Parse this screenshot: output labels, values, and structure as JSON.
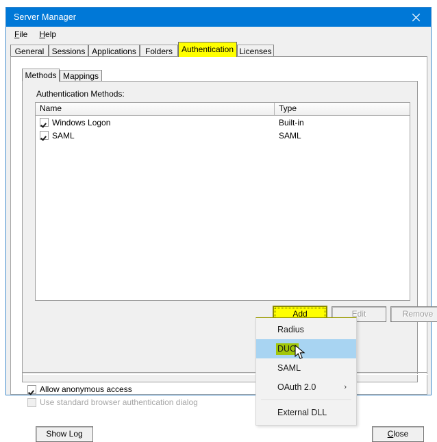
{
  "window": {
    "title": "Server Manager",
    "close_icon": "close-icon",
    "accent_titlebar": "#0078D7",
    "highlight_yellow": "#FFFF00",
    "menu_selection_blue": "#A8D4F2",
    "menu_item_highlight_green": "#A2C60A"
  },
  "menubar": {
    "items": [
      {
        "label": "File",
        "accel": "F"
      },
      {
        "label": "Help",
        "accel": "H"
      }
    ]
  },
  "outer_tabs": {
    "items": [
      {
        "label": "General",
        "active": false
      },
      {
        "label": "Sessions",
        "active": false
      },
      {
        "label": "Applications",
        "active": false
      },
      {
        "label": "Folders",
        "active": false
      },
      {
        "label": "Authentication",
        "active": true
      },
      {
        "label": "Licenses",
        "active": false
      }
    ]
  },
  "inner_tabs": {
    "items": [
      {
        "label": "Methods",
        "active": true
      },
      {
        "label": "Mappings",
        "active": false
      }
    ]
  },
  "methods_panel": {
    "group_label": "Authentication Methods:",
    "columns": [
      "Name",
      "Type"
    ],
    "rows": [
      {
        "checked": true,
        "name": "Windows Logon",
        "type": "Built-in"
      },
      {
        "checked": true,
        "name": "SAML",
        "type": "SAML"
      }
    ],
    "buttons": {
      "add": {
        "label": "Add",
        "enabled": true,
        "focused": true,
        "highlighted": true
      },
      "edit": {
        "label": "Edit",
        "enabled": false
      },
      "remove": {
        "label": "Remove",
        "enabled": false
      }
    }
  },
  "options": {
    "allow_anonymous": {
      "label": "Allow anonymous access",
      "checked": true,
      "enabled": true
    },
    "standard_browser_dialog": {
      "label": "Use standard browser authentication dialog",
      "checked": false,
      "enabled": false
    }
  },
  "footer": {
    "show_log": {
      "label": "Show Log",
      "accel": ""
    },
    "close": {
      "label": "Close",
      "accel": "C"
    }
  },
  "add_menu": {
    "items": [
      {
        "label": "Radius",
        "selected": false,
        "submenu": false,
        "separator_before": false
      },
      {
        "label": "DUO",
        "selected": true,
        "submenu": false,
        "separator_before": false
      },
      {
        "label": "SAML",
        "selected": false,
        "submenu": false,
        "separator_before": false
      },
      {
        "label": "OAuth 2.0",
        "selected": false,
        "submenu": true,
        "separator_before": false
      },
      {
        "label": "External DLL",
        "selected": false,
        "submenu": false,
        "separator_before": true
      }
    ],
    "submenu_arrow_glyph": "›"
  },
  "cursor": {
    "icon": "mouse-pointer-icon"
  }
}
